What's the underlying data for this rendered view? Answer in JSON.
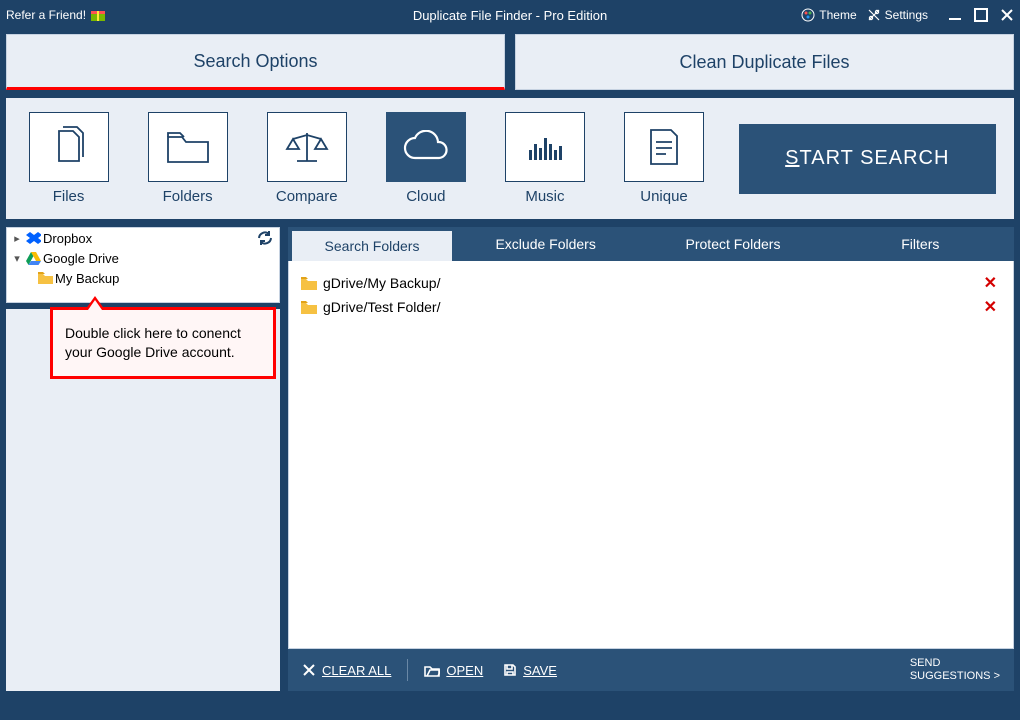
{
  "titlebar": {
    "refer_label": "Refer a Friend!",
    "app_title": "Duplicate File Finder - Pro Edition",
    "theme_label": "Theme",
    "settings_label": "Settings"
  },
  "top_tabs": {
    "search_options": "Search Options",
    "clean_dupes": "Clean Duplicate Files",
    "active": "search_options"
  },
  "categories": [
    {
      "id": "files",
      "label": "Files"
    },
    {
      "id": "folders",
      "label": "Folders"
    },
    {
      "id": "compare",
      "label": "Compare"
    },
    {
      "id": "cloud",
      "label": "Cloud"
    },
    {
      "id": "music",
      "label": "Music"
    },
    {
      "id": "unique",
      "label": "Unique"
    }
  ],
  "active_category": "cloud",
  "start_button": {
    "prefix": "S",
    "rest": "TART SEARCH"
  },
  "tree": {
    "dropbox": "Dropbox",
    "gdrive": "Google Drive",
    "gdrive_children": [
      "My Backup"
    ]
  },
  "callout": {
    "text": "Double click here to conenct your Google Drive account."
  },
  "sub_tabs": [
    "Search Folders",
    "Exclude Folders",
    "Protect Folders",
    "Filters"
  ],
  "active_sub_tab": 0,
  "folders": [
    "gDrive/My Backup/",
    "gDrive/Test Folder/"
  ],
  "bottom": {
    "clear_prefix": "C",
    "clear_rest": "LEAR ALL",
    "open_prefix": "O",
    "open_rest": "PEN",
    "save_prefix": "S",
    "save_rest": "AVE",
    "send_line1": "SEND",
    "send_line2": "SUGGESTIONS >"
  },
  "colors": {
    "bg_dark": "#1e4267",
    "panel_mid": "#2b5278",
    "panel_light": "#e9eef5",
    "accent_red": "#ff0000"
  }
}
